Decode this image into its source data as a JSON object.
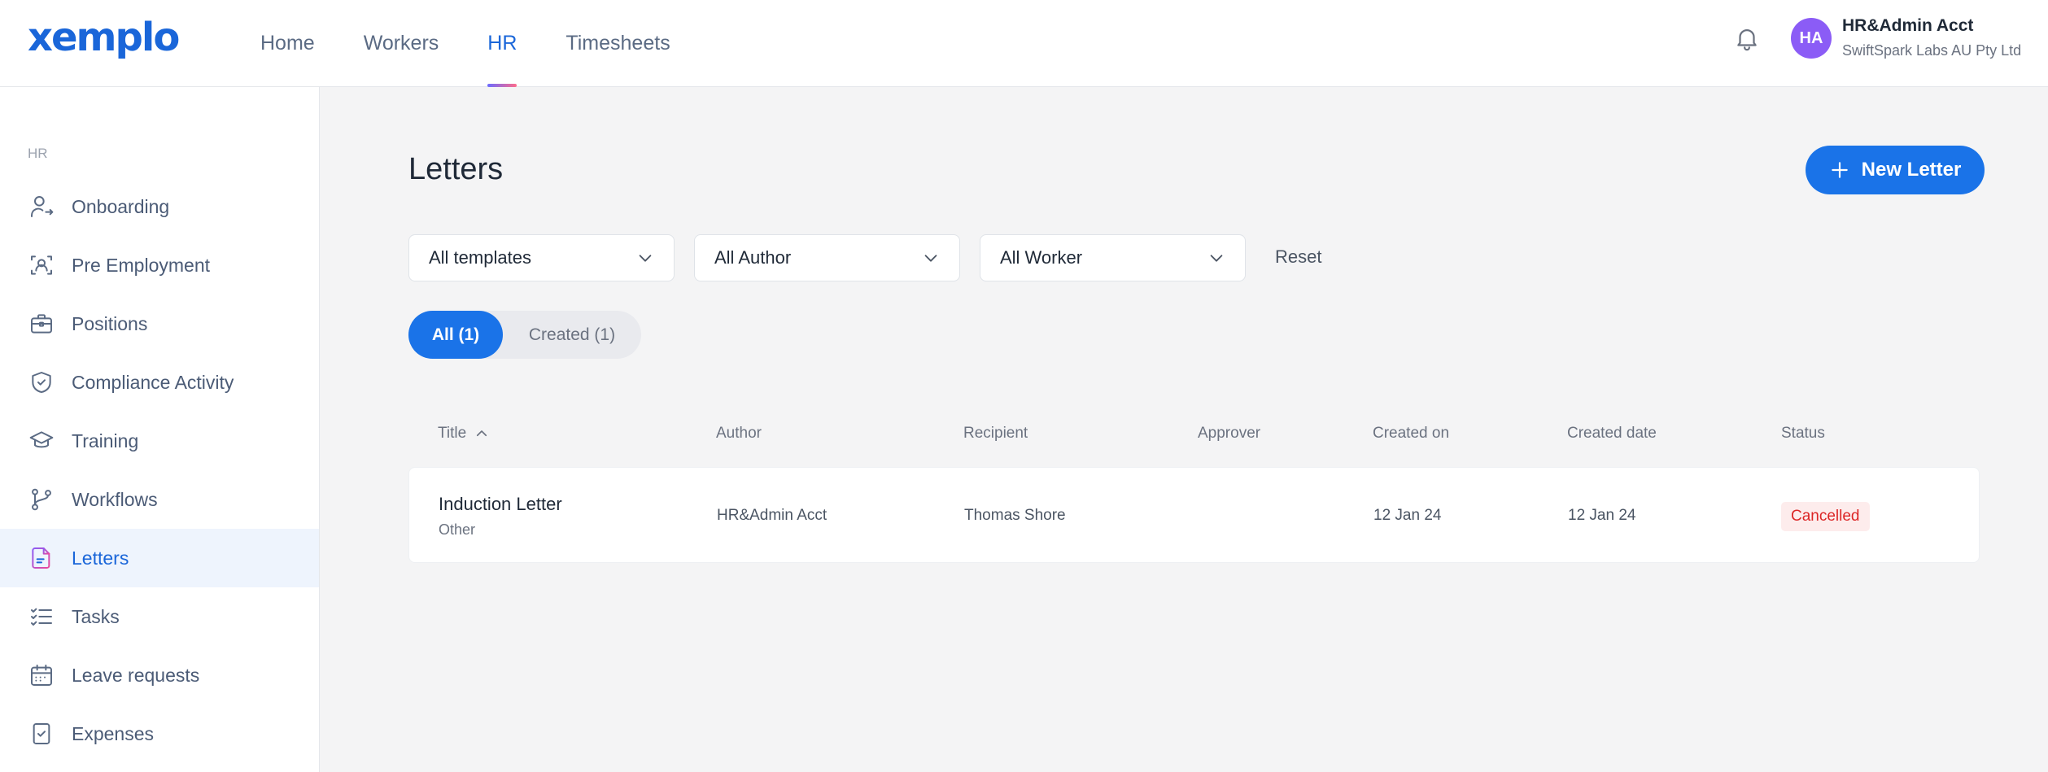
{
  "app": {
    "logo_text": "xemplo",
    "brand_color": "#1a66d9"
  },
  "nav": {
    "items": [
      {
        "label": "Home"
      },
      {
        "label": "Workers"
      },
      {
        "label": "HR",
        "active": true
      },
      {
        "label": "Timesheets"
      }
    ]
  },
  "user": {
    "initials": "HA",
    "name": "HR&Admin Acct",
    "org": "SwiftSpark Labs AU Pty Ltd",
    "avatar_color": "#8b5cf6"
  },
  "sidebar": {
    "heading": "HR",
    "items": [
      {
        "label": "Onboarding",
        "icon": "user-arrow-icon"
      },
      {
        "label": "Pre Employment",
        "icon": "user-scan-icon"
      },
      {
        "label": "Positions",
        "icon": "briefcase-icon"
      },
      {
        "label": "Compliance Activity",
        "icon": "shield-check-icon"
      },
      {
        "label": "Training",
        "icon": "graduation-cap-icon"
      },
      {
        "label": "Workflows",
        "icon": "git-branch-icon"
      },
      {
        "label": "Letters",
        "icon": "document-icon",
        "active": true
      },
      {
        "label": "Tasks",
        "icon": "checklist-icon"
      },
      {
        "label": "Leave requests",
        "icon": "calendar-icon"
      },
      {
        "label": "Expenses",
        "icon": "receipt-icon"
      }
    ]
  },
  "main": {
    "title": "Letters",
    "new_button": "New Letter",
    "filters": {
      "template": "All templates",
      "author": "All Author",
      "worker": "All Worker",
      "reset": "Reset"
    },
    "segments": [
      {
        "label": "All (1)",
        "active": true
      },
      {
        "label": "Created (1)",
        "active": false
      }
    ],
    "table": {
      "columns": [
        "Title",
        "Author",
        "Recipient",
        "Approver",
        "Created on",
        "Created date",
        "Status"
      ],
      "sort_column": "Title",
      "sort_direction": "ascending",
      "rows": [
        {
          "title": "Induction Letter",
          "subtitle": "Other",
          "author": "HR&Admin Acct",
          "recipient": "Thomas Shore",
          "approver": "",
          "created_on": "12 Jan 24",
          "created_date": "12 Jan 24",
          "status": "Cancelled",
          "status_color": "#dc2626"
        }
      ]
    }
  }
}
